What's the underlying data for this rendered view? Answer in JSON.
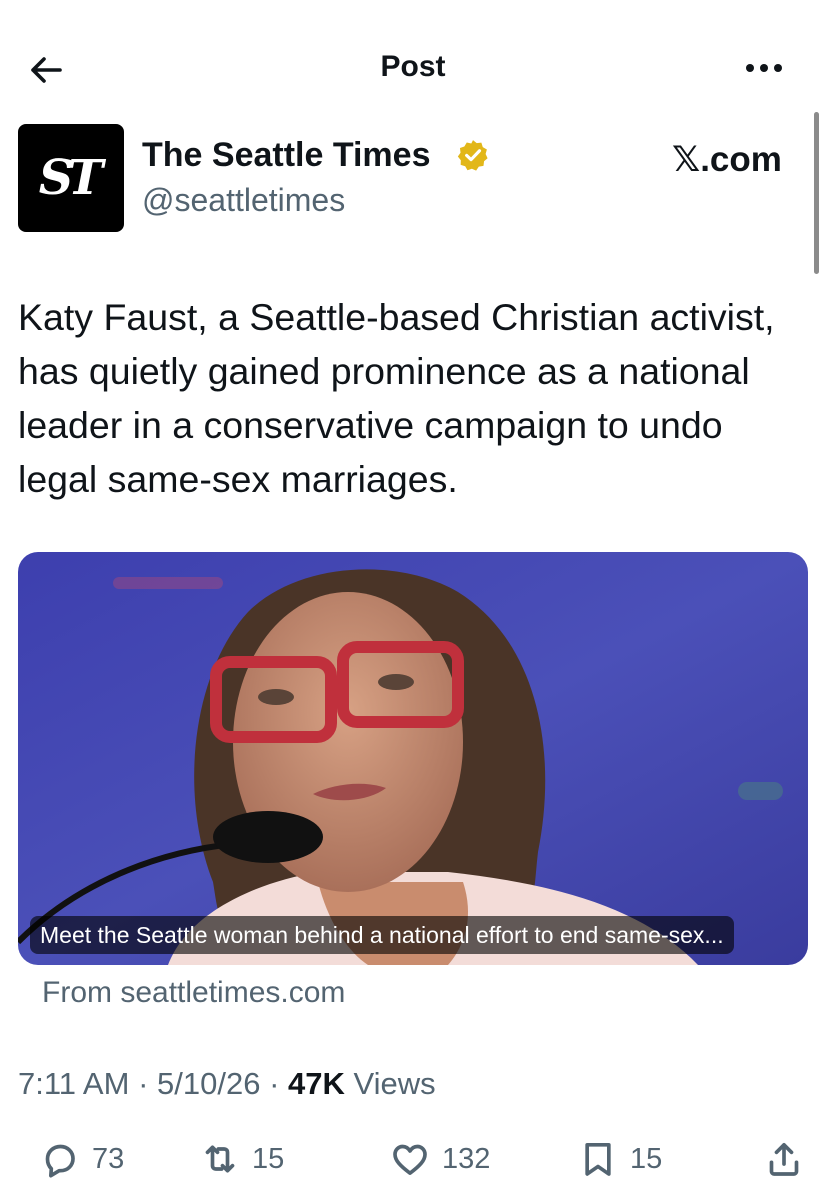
{
  "header": {
    "title": "Post",
    "back_icon": "arrow-left-icon",
    "more_icon": "more-horizontal-icon"
  },
  "author": {
    "avatar_text": "ST",
    "name": "The Seattle Times",
    "handle": "@seattletimes",
    "verified": true,
    "verified_color": "#e2b719",
    "site": "𝕏.com"
  },
  "post": {
    "text": "Katy Faust, a Seattle-based Christian activist, has quietly gained prominence as a national leader in a conservative campaign to undo legal same-sex marriages."
  },
  "link_card": {
    "caption": "Meet the Seattle woman behind a national effort to end same-sex...",
    "source": "From seattletimes.com"
  },
  "meta": {
    "time": "7:11 AM",
    "date": "5/10/26",
    "views_count": "47K",
    "views_label": "Views",
    "separator": "·"
  },
  "actions": {
    "replies": "73",
    "reposts": "15",
    "likes": "132",
    "bookmarks": "15"
  },
  "colors": {
    "text": "#0f1419",
    "muted": "#536471",
    "card_bg": "#4a4db2"
  }
}
